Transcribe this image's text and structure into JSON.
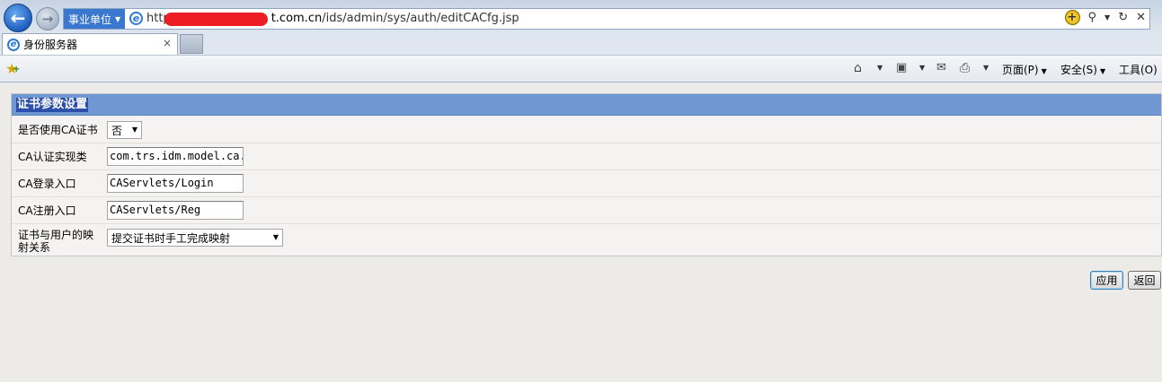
{
  "browser": {
    "site_tag": "事业单位",
    "url_prefix": "http",
    "url_host": "t.com.cn",
    "url_path": "/ids/admin/sys/auth/editCACfg.jsp",
    "tab_title": "身份服务器",
    "tab_close": "×",
    "menu": {
      "page": "页面(P)",
      "safety": "安全(S)",
      "tools": "工具(O)"
    },
    "icons": [
      "back-arrow",
      "forward-arrow",
      "ie-logo",
      "compatibility",
      "search",
      "refresh",
      "close",
      "favorites-star",
      "home",
      "rss",
      "mail",
      "print"
    ]
  },
  "panel": {
    "title": "证书参数设置",
    "rows": [
      {
        "label": "是否使用CA证书",
        "type": "select",
        "value": "否"
      },
      {
        "label": "CA认证实现类",
        "type": "input",
        "value": "com.trs.idm.model.ca."
      },
      {
        "label": "CA登录入口",
        "type": "input",
        "value": "CAServlets/Login"
      },
      {
        "label": "CA注册入口",
        "type": "input",
        "value": "CAServlets/Reg"
      },
      {
        "label": "证书与用户的映射关系",
        "type": "select",
        "value": "提交证书时手工完成映射"
      }
    ]
  },
  "buttons": {
    "apply": "应用",
    "back": "返回"
  },
  "colors": {
    "panel_header": "#6f98d3",
    "title_highlight": "#2b4ea8",
    "page_bg": "#ecebe8"
  }
}
